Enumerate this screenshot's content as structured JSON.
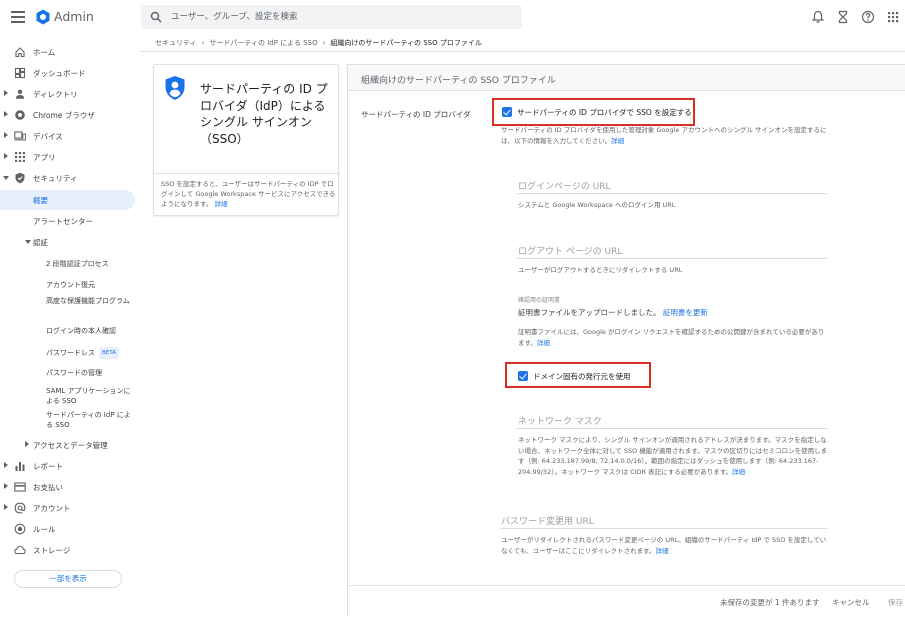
{
  "header": {
    "app_title": "Admin",
    "search_placeholder": "ユーザー、グループ、設定を検索",
    "logo_color": "#1a73e8"
  },
  "sidebar": {
    "items": [
      {
        "label": "ホーム",
        "icon": "home-icon"
      },
      {
        "label": "ダッシュボード",
        "icon": "dashboard-icon"
      },
      {
        "label": "ディレクトリ",
        "icon": "person-icon"
      },
      {
        "label": "Chrome ブラウザ",
        "icon": "chrome-icon"
      },
      {
        "label": "デバイス",
        "icon": "devices-icon"
      },
      {
        "label": "アプリ",
        "icon": "apps-grid-icon"
      },
      {
        "label": "セキュリティ",
        "icon": "shield-icon"
      },
      {
        "label": "概要"
      },
      {
        "label": "アラートセンター"
      },
      {
        "label": "認証"
      },
      {
        "label": "2 段階認証プロセス"
      },
      {
        "label": "アカウント復元"
      },
      {
        "label": "高度な保護機能プログラム"
      },
      {
        "label": "ログイン時の本人確認"
      },
      {
        "label": "パスワードレス",
        "badge": "BETA"
      },
      {
        "label": "パスワードの管理"
      },
      {
        "label": "SAML アプリケーションによる SSO"
      },
      {
        "label": "サードパーティの IdP による SSO"
      },
      {
        "label": "アクセスとデータ管理"
      },
      {
        "label": "レポート",
        "icon": "bar-chart-icon"
      },
      {
        "label": "お支払い",
        "icon": "credit-card-icon"
      },
      {
        "label": "アカウント",
        "icon": "at-sign-icon"
      },
      {
        "label": "ルール",
        "icon": "rules-icon"
      },
      {
        "label": "ストレージ",
        "icon": "cloud-icon"
      }
    ],
    "show_less_label": "一部を表示"
  },
  "breadcrumb": {
    "items": [
      "セキュリティ",
      "サードパーティの IdP による SSO",
      "組織向けのサードパーティの SSO プロファイル"
    ]
  },
  "info_card": {
    "title": "サードパーティの ID プロバイダ（IdP）によるシングル サインオン（SSO）",
    "description": "SSO を設定すると、ユーザーはサードパーティの IDP でログインして Google Workspace サービスにアクセスできるようになります。",
    "link": "詳細"
  },
  "panel": {
    "title": "組織向けのサードパーティの SSO プロファイル",
    "row_label": "サードパーティの ID プロバイダ",
    "sso_checkbox_label": "サードパーティの ID プロバイダで SSO を設定する",
    "sso_desc": "サードパーティの ID プロバイダを使用した管理対象 Google アカウントへのシングル サインオンを設定するには、以下の情報を入力してください。",
    "sso_desc_link": "詳細",
    "login_url_label": "ログインページの URL",
    "login_url_desc": "システムと Google Workspace へのログイン用 URL",
    "logout_url_label": "ログアウト ページの URL",
    "logout_url_desc": "ユーザーがログアウトするときにリダイレクトする URL",
    "cert_small_label": "確認用の証明書",
    "cert_uploaded": "証明書ファイルをアップロードしました。",
    "cert_update_link": "証明書を更新",
    "cert_desc": "証明書ファイルには、Google がログイン リクエストを確認するための公開鍵が含まれている必要があります。",
    "cert_desc_link": "詳細",
    "domain_issuer_label": "ドメイン固有の発行元を使用",
    "network_mask_label": "ネットワーク マスク",
    "network_mask_desc": "ネットワーク マスクにより、シングル サインオンが適用されるアドレスが決まります。マスクを指定しない場合、ネットワーク全体に対して SSO 機能が適用されます。マスクの区切りにはセミコロンを使用します（例: 64.233.187.99/8; 72.14.0.0/16）。範囲の指定にはダッシュを使用します（例: 64.233.167-204.99/32）。ネットワーク マスクは CIDR 表記にする必要があります。",
    "network_mask_link": "詳細",
    "password_change_label": "パスワード変更用 URL",
    "password_change_desc": "ユーザーがリダイレクトされるパスワード変更ページの URL。組織のサードパーティ IdP で SSO を設定していなくても、ユーザーはここにリダイレクトされます。",
    "password_change_link": "詳細",
    "unsaved_text": "未保存の変更が 1 件あります",
    "cancel_label": "キャンセル",
    "save_label": "保存"
  },
  "colors": {
    "accent": "#1a73e8",
    "highlight_border": "#d93025"
  }
}
